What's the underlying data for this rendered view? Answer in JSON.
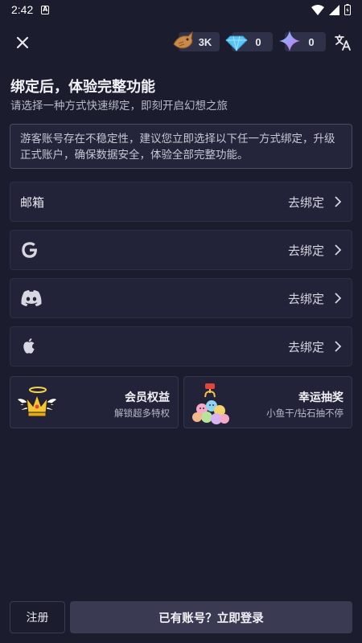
{
  "status_bar": {
    "time": "2:42",
    "notification_icon": "a-notification-icon",
    "icons": [
      "wifi-icon",
      "signal-icon",
      "battery-icon"
    ]
  },
  "top_bar": {
    "close_icon": "close-icon",
    "currencies": [
      {
        "name": "fish",
        "icon": "fish-icon",
        "value": "3K"
      },
      {
        "name": "diamond",
        "icon": "diamond-icon",
        "value": "0"
      },
      {
        "name": "star",
        "icon": "star-icon",
        "value": "0"
      }
    ],
    "translate_icon": "translate-icon"
  },
  "header": {
    "title": "绑定后，体验完整功能",
    "subtitle": "请选择一种方式快速绑定，即刻开启幻想之旅"
  },
  "notice": {
    "text": "游客账号存在不稳定性，建议您立即选择以下任一方式绑定，升级正式账户，确保数据安全，体验全部完整功能。"
  },
  "bind_options": [
    {
      "label": "邮箱",
      "icon": "",
      "action": "去绑定"
    },
    {
      "label": "",
      "icon": "google-icon",
      "action": "去绑定"
    },
    {
      "label": "",
      "icon": "discord-icon",
      "action": "去绑定"
    },
    {
      "label": "",
      "icon": "apple-icon",
      "action": "去绑定"
    }
  ],
  "promos": [
    {
      "title": "会员权益",
      "desc": "解锁超多特权",
      "icon": "winged-crown-icon"
    },
    {
      "title": "幸运抽奖",
      "desc": "小鱼干/钻石抽不停",
      "icon": "claw-machine-plush-icon"
    }
  ],
  "bottom": {
    "register_label": "注册",
    "login_label": "已有账号？立即登录"
  },
  "colors": {
    "background": "#1b1c2e",
    "card": "#222338",
    "button": "#3a3b52"
  }
}
